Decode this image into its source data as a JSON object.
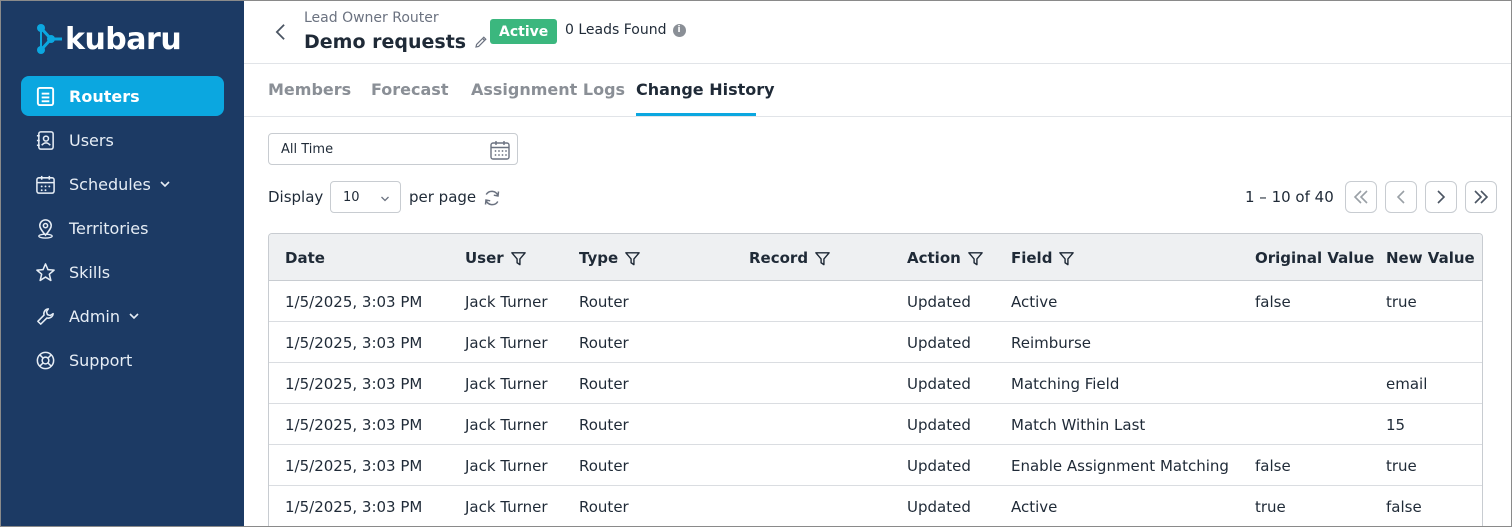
{
  "brand": {
    "name": "kubaru"
  },
  "sidebar": {
    "items": [
      {
        "label": "Routers",
        "icon": "list-icon",
        "active": true
      },
      {
        "label": "Users",
        "icon": "contact-book-icon"
      },
      {
        "label": "Schedules",
        "icon": "calendar-icon",
        "has_chevron": true
      },
      {
        "label": "Territories",
        "icon": "location-pin-icon"
      },
      {
        "label": "Skills",
        "icon": "star-icon"
      },
      {
        "label": "Admin",
        "icon": "wrench-icon",
        "has_chevron": true
      },
      {
        "label": "Support",
        "icon": "lifebuoy-icon"
      }
    ]
  },
  "header": {
    "breadcrumb": "Lead Owner Router",
    "title": "Demo requests",
    "status_badge": "Active",
    "leads_found": "0 Leads Found"
  },
  "tabs": [
    {
      "label": "Members"
    },
    {
      "label": "Forecast"
    },
    {
      "label": "Assignment Logs"
    },
    {
      "label": "Change History",
      "active": true
    }
  ],
  "filters": {
    "date_range": "All Time",
    "display_label": "Display",
    "per_page_value": "10",
    "per_page_label": "per page"
  },
  "pagination": {
    "range_text": "1 – 10 of 40"
  },
  "table": {
    "columns": [
      "Date",
      "User",
      "Type",
      "Record",
      "Action",
      "Field",
      "Original Value",
      "New Value"
    ],
    "rows": [
      [
        "1/5/2025, 3:03 PM",
        "Jack Turner",
        "Router",
        "",
        "Updated",
        "Active",
        "false",
        "true"
      ],
      [
        "1/5/2025, 3:03 PM",
        "Jack Turner",
        "Router",
        "",
        "Updated",
        "Reimburse",
        "",
        ""
      ],
      [
        "1/5/2025, 3:03 PM",
        "Jack Turner",
        "Router",
        "",
        "Updated",
        "Matching Field",
        "",
        "email"
      ],
      [
        "1/5/2025, 3:03 PM",
        "Jack Turner",
        "Router",
        "",
        "Updated",
        "Match Within Last",
        "",
        "15"
      ],
      [
        "1/5/2025, 3:03 PM",
        "Jack Turner",
        "Router",
        "",
        "Updated",
        "Enable Assignment Matching",
        "false",
        "true"
      ],
      [
        "1/5/2025, 3:03 PM",
        "Jack Turner",
        "Router",
        "",
        "Updated",
        "Active",
        "true",
        "false"
      ]
    ]
  },
  "colors": {
    "sidebar_bg": "#1c3a64",
    "accent": "#0ba7e0",
    "badge_green": "#3bb77e"
  }
}
